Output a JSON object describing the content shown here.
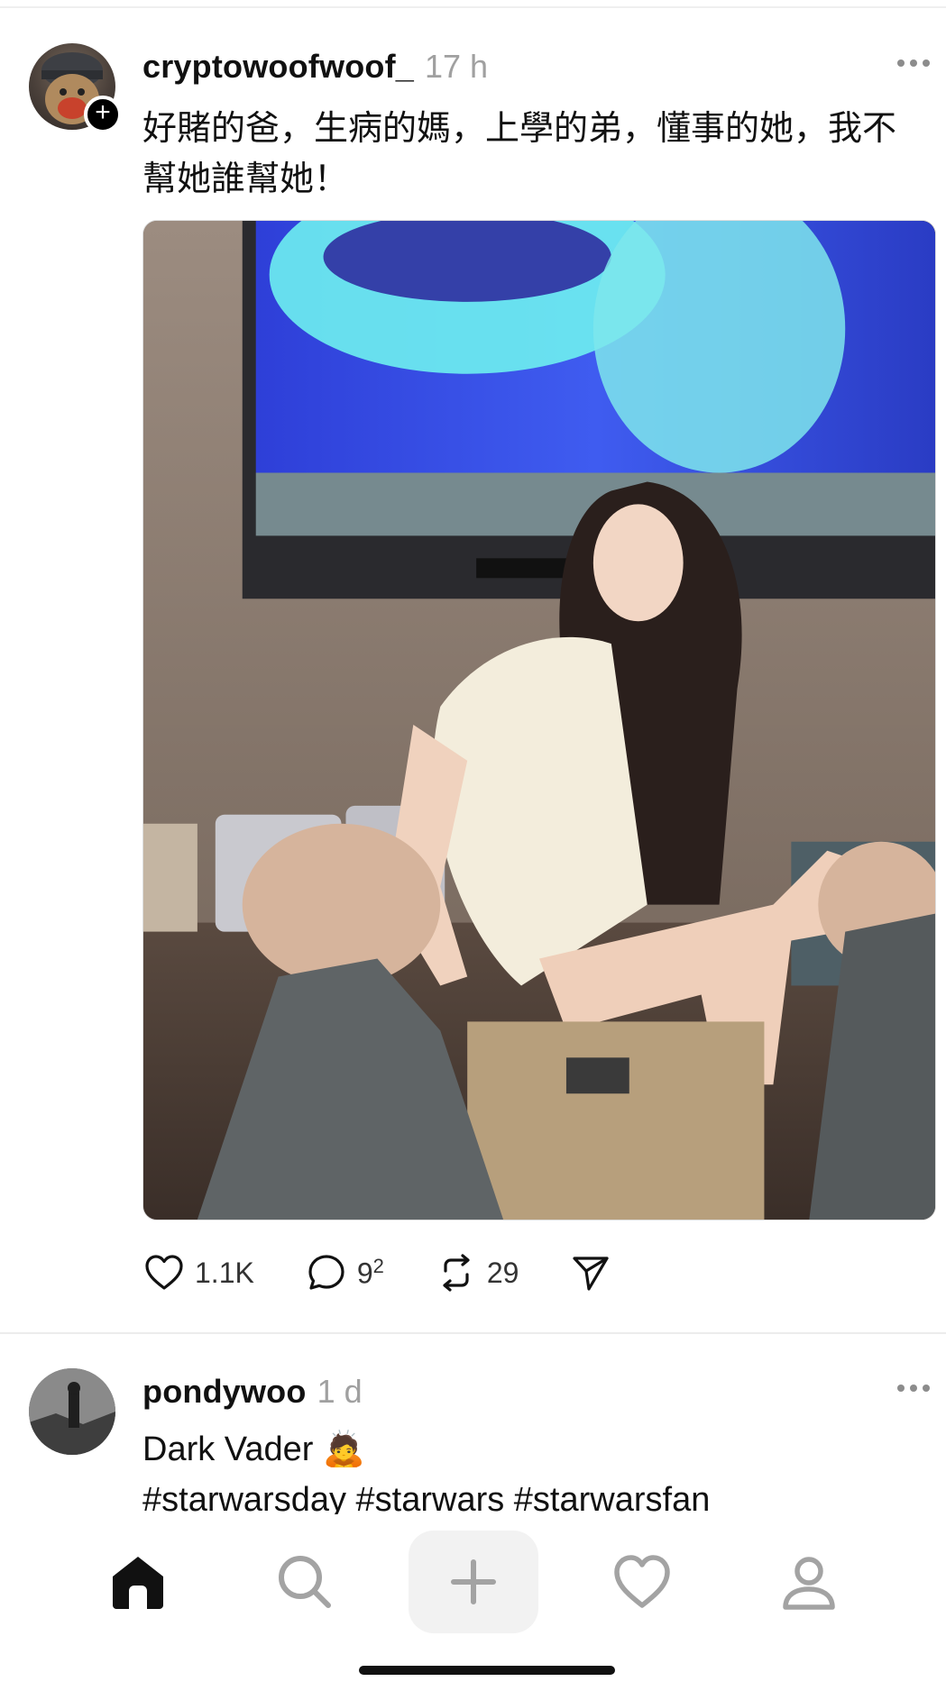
{
  "feed": {
    "posts": [
      {
        "username": "cryptowoofwoof_",
        "time": "17 h",
        "caption": "好賭的爸，生病的媽，上學的弟，懂事的她，我不幫她誰幫她！",
        "actions": {
          "likes": "1.1K",
          "replies": "9",
          "replies_sup": "2",
          "reposts": "29"
        }
      },
      {
        "username": "pondywoo",
        "time": "1 d",
        "caption_line1": "Dark Vader 🙇",
        "caption_line2": "#starwarsday #starwars #starwarsfan"
      }
    ]
  },
  "nav": {
    "items": [
      "home-icon",
      "search-icon",
      "create-icon",
      "heart-icon",
      "profile-icon"
    ]
  },
  "colors": {
    "text": "#111111",
    "muted": "#a0a0a0",
    "divider": "#ececec"
  }
}
